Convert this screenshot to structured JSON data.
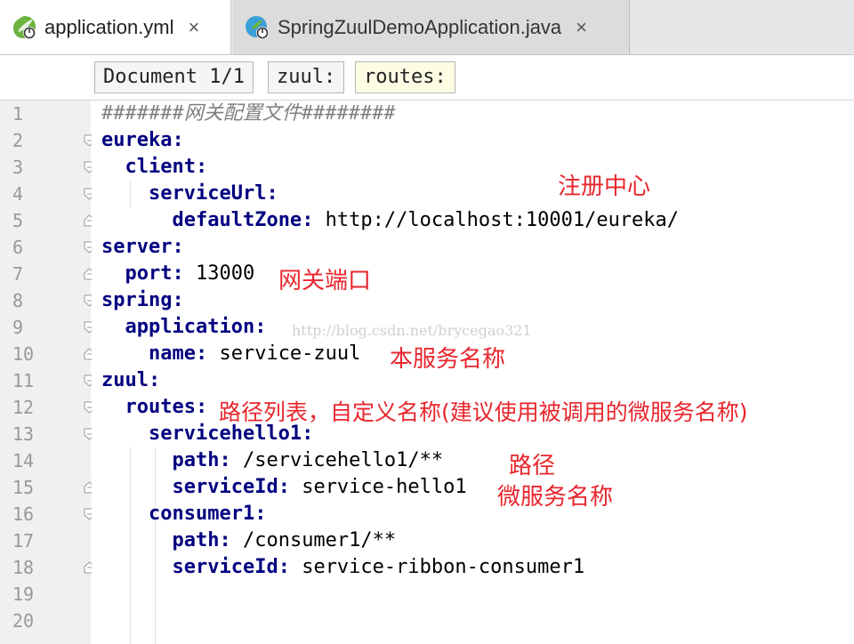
{
  "tabs": [
    {
      "label": "application.yml",
      "icon": "spring-yaml-file-icon",
      "active": true
    },
    {
      "label": "SpringZuulDemoApplication.java",
      "icon": "spring-boot-class-icon",
      "active": false
    }
  ],
  "tab_close_glyph": "×",
  "breadcrumbs": [
    "Document 1/1",
    "zuul:",
    "routes:"
  ],
  "editor": {
    "highlighted_line": 15,
    "line_numbers": [
      "1",
      "2",
      "3",
      "4",
      "5",
      "6",
      "7",
      "8",
      "9",
      "10",
      "11",
      "12",
      "13",
      "14",
      "15",
      "16",
      "17",
      "18",
      "19",
      "20"
    ],
    "lines": [
      {
        "comment": "#######网关配置文件########"
      },
      {
        "indent": "",
        "key": "eureka",
        "sep": ":",
        "value": ""
      },
      {
        "indent": "  ",
        "key": "client",
        "sep": ":",
        "value": ""
      },
      {
        "indent": "    ",
        "key": "serviceUrl",
        "sep": ":",
        "value": ""
      },
      {
        "indent": "      ",
        "key": "defaultZone",
        "sep": ":",
        "value": " http://localhost:10001/eureka/"
      },
      {
        "indent": "",
        "key": "server",
        "sep": ":",
        "value": ""
      },
      {
        "indent": "  ",
        "key": "port",
        "sep": ":",
        "value": " 13000"
      },
      {
        "indent": "",
        "key": "spring",
        "sep": ":",
        "value": ""
      },
      {
        "indent": "  ",
        "key": "application",
        "sep": ":",
        "value": ""
      },
      {
        "indent": "    ",
        "key": "name",
        "sep": ":",
        "value": " service-zuul"
      },
      {
        "indent": "",
        "key": "zuul",
        "sep": ":",
        "value": ""
      },
      {
        "indent": "  ",
        "key": "routes",
        "sep": ":",
        "value": ""
      },
      {
        "indent": "    ",
        "key": "servicehello1",
        "sep": ":",
        "value": ""
      },
      {
        "indent": "      ",
        "key": "path",
        "sep": ":",
        "value": " /servicehello1/**"
      },
      {
        "indent": "      ",
        "key": "serviceId",
        "sep": ":",
        "value": " service-hello1"
      },
      {
        "indent": "    ",
        "key": "consumer1",
        "sep": ":",
        "value": ""
      },
      {
        "indent": "      ",
        "key": "path",
        "sep": ":",
        "value": " /consumer1/**"
      },
      {
        "indent": "      ",
        "key": "serviceId",
        "sep": ":",
        "value": " service-ribbon-consumer1"
      },
      {
        "indent": "",
        "key": "",
        "sep": "",
        "value": ""
      },
      {
        "indent": "",
        "key": "",
        "sep": "",
        "value": ""
      }
    ]
  },
  "annotations": {
    "registry": "注册中心",
    "gateway_port": "网关端口",
    "service_name": "本服务名称",
    "routes": "路径列表，自定义名称(建议使用被调用的微服务名称)",
    "path": "路径",
    "microservice_name": "微服务名称"
  },
  "watermark": "http://blog.csdn.net/brycegao321",
  "colors": {
    "keyword": "#000080",
    "comment": "#808080",
    "annotation": "#e8262d",
    "current_line": "#fcfae3",
    "gutter": "#f0f0f0"
  }
}
